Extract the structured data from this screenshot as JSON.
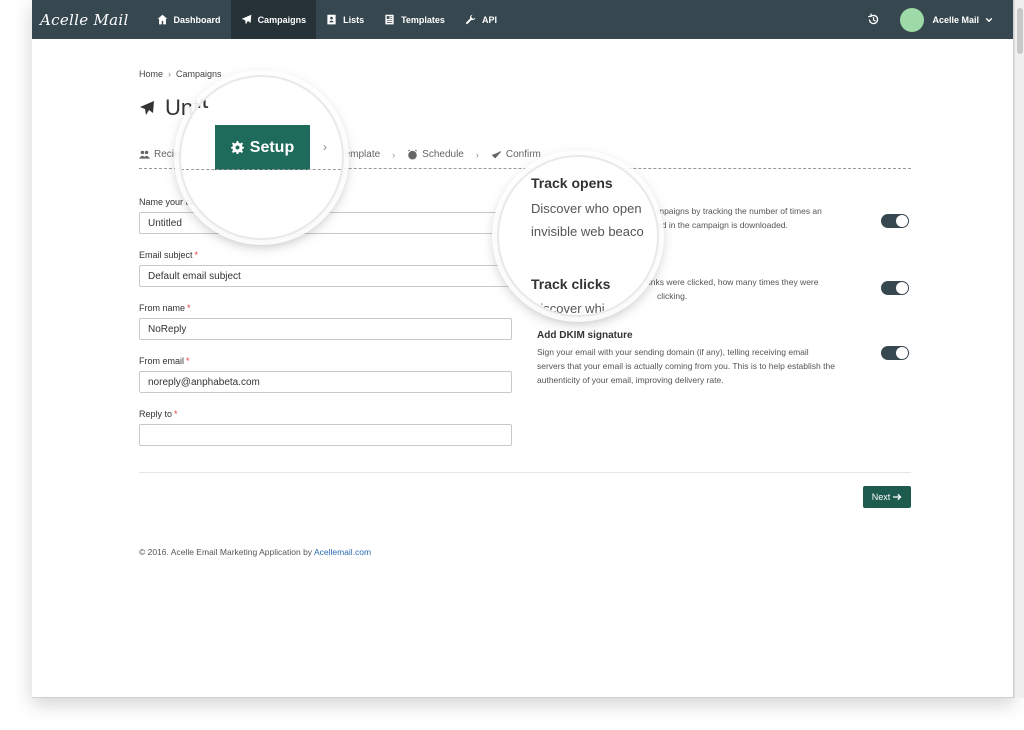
{
  "brand": "Acelle Mail",
  "nav": {
    "items": [
      {
        "label": "Dashboard",
        "icon": "home-icon"
      },
      {
        "label": "Campaigns",
        "icon": "paper-plane-icon",
        "active": true
      },
      {
        "label": "Lists",
        "icon": "address-book-icon"
      },
      {
        "label": "Templates",
        "icon": "newspaper-icon"
      },
      {
        "label": "API",
        "icon": "wrench-icon"
      }
    ],
    "user": "Acelle Mail"
  },
  "breadcrumb": {
    "home": "Home",
    "current": "Campaigns"
  },
  "page_title": "Untitled",
  "page_title_magnified": "Unt",
  "steps": [
    "Recipients",
    "Setup",
    "Template",
    "Schedule",
    "Confirm"
  ],
  "steps_visible": [
    "Recip",
    "Template",
    "Schedule",
    "Confirm"
  ],
  "form": {
    "name": {
      "label": "Name your campaign",
      "label_visible": "Name your ca",
      "value": "Untitled"
    },
    "subject": {
      "label": "Email subject",
      "value": "Default email subject"
    },
    "from_name": {
      "label": "From name",
      "value": "NoReply"
    },
    "from_email": {
      "label": "From email",
      "value": "noreply@anphabeta.com"
    },
    "reply_to": {
      "label": "Reply to",
      "value": ""
    }
  },
  "options": [
    {
      "title": "Track opens",
      "desc_visible": "mpaigns by tracking the number of times an",
      "desc_visible_2": "ed in the campaign is downloaded.",
      "enabled": true
    },
    {
      "title": "Track clicks",
      "desc_visible": "links were clicked, how many times they were",
      "desc_visible_2": "clicking.",
      "enabled": true
    },
    {
      "title": "Add DKIM signature",
      "desc": "Sign your email with your sending domain (if any), telling receiving email servers that your email is actually coming from you. This is to help establish the authenticity of your email, improving delivery rate.",
      "enabled": true
    }
  ],
  "magnifier_setup": {
    "label": "Setup"
  },
  "magnifier_options": {
    "track_opens_title": "Track opens",
    "track_opens_line1": "Discover who open",
    "track_opens_line2": "invisible web beaco",
    "track_clicks_title": "Track clicks",
    "track_clicks_line": "Discover whi"
  },
  "next_button": "Next",
  "footer": {
    "text": "© 2016. Acelle Email Marketing Application by ",
    "link": "Acellemail.com"
  },
  "colors": {
    "navbar": "#37474f",
    "active_nav": "#263238",
    "accent": "#1e6b5c",
    "required": "#e53935"
  }
}
